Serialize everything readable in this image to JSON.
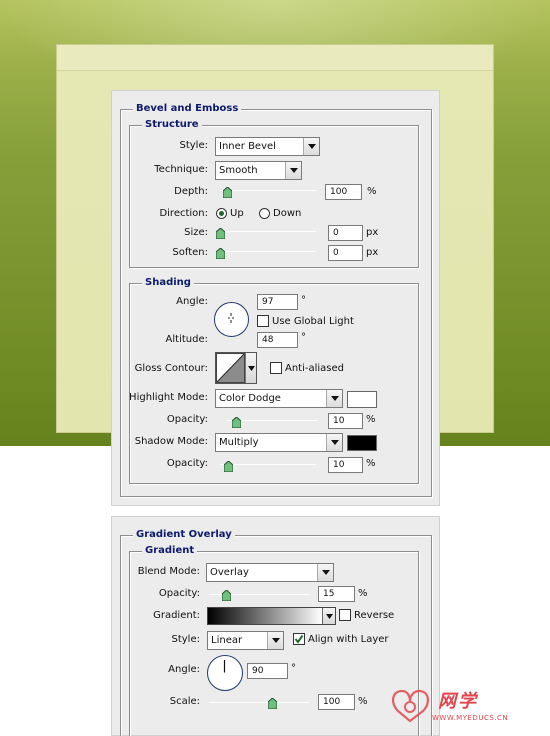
{
  "bevel": {
    "title": "Bevel and Emboss",
    "structure": {
      "title": "Structure",
      "style_label": "Style:",
      "style_value": "Inner Bevel",
      "technique_label": "Technique:",
      "technique_value": "Smooth",
      "depth_label": "Depth:",
      "depth_value": "100",
      "depth_unit": "%",
      "direction_label": "Direction:",
      "direction_up": "Up",
      "direction_down": "Down",
      "size_label": "Size:",
      "size_value": "0",
      "size_unit": "px",
      "soften_label": "Soften:",
      "soften_value": "0",
      "soften_unit": "px"
    },
    "shading": {
      "title": "Shading",
      "angle_label": "Angle:",
      "angle_value": "97",
      "angle_unit": "°",
      "use_global_light": "Use Global Light",
      "altitude_label": "Altitude:",
      "altitude_value": "48",
      "altitude_unit": "°",
      "gloss_label": "Gloss Contour:",
      "anti_aliased": "Anti-aliased",
      "highlight_label": "Highlight Mode:",
      "highlight_value": "Color Dodge",
      "highlight_color": "#ffffff",
      "highlight_opacity_label": "Opacity:",
      "highlight_opacity_value": "10",
      "highlight_opacity_unit": "%",
      "shadow_label": "Shadow Mode:",
      "shadow_value": "Multiply",
      "shadow_color": "#000000",
      "shadow_opacity_label": "Opacity:",
      "shadow_opacity_value": "10",
      "shadow_opacity_unit": "%"
    }
  },
  "gradient_overlay": {
    "title": "Gradient Overlay",
    "section": "Gradient",
    "blend_label": "Blend Mode:",
    "blend_value": "Overlay",
    "opacity_label": "Opacity:",
    "opacity_value": "15",
    "opacity_unit": "%",
    "gradient_label": "Gradient:",
    "reverse_label": "Reverse",
    "style_label": "Style:",
    "style_value": "Linear",
    "align_label": "Align with Layer",
    "angle_label": "Angle:",
    "angle_value": "90",
    "angle_unit": "°",
    "scale_label": "Scale:",
    "scale_value": "100",
    "scale_unit": "%"
  },
  "watermark": {
    "title": "网学",
    "url": "WWW.MYEDUCS.CN",
    "color": "#e2464c"
  }
}
